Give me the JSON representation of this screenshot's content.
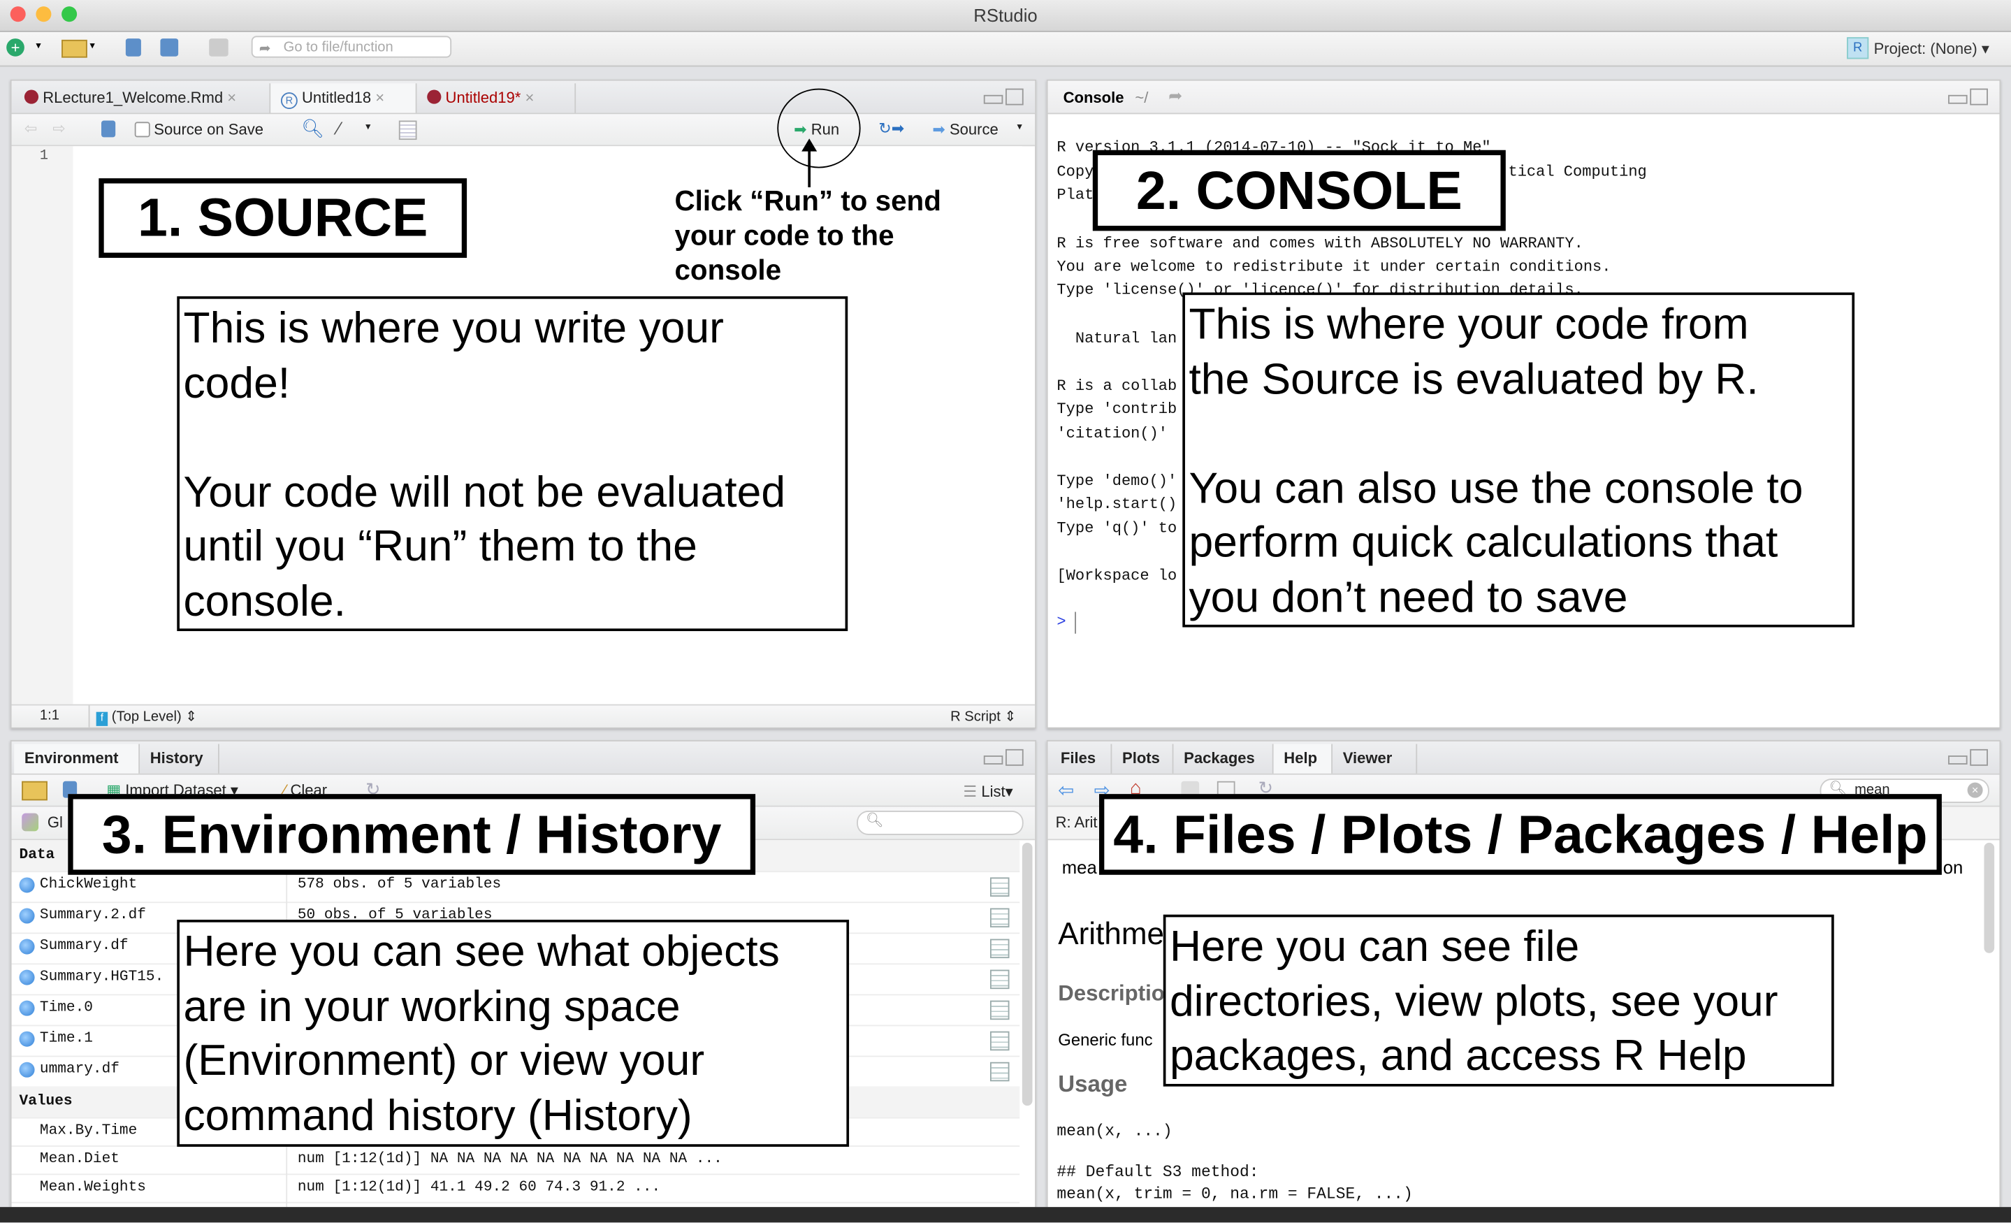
{
  "window": {
    "title": "RStudio",
    "traffic_lights": {
      "close": "#fc605c",
      "minimize": "#fdbc40",
      "zoom": "#34c84a"
    }
  },
  "toolbar": {
    "goto_placeholder": "Go to file/function",
    "project_label": "Project: (None)",
    "icons": [
      "new-file-icon",
      "open-folder-icon",
      "save-icon",
      "save-all-icon",
      "print-icon"
    ]
  },
  "source": {
    "tabs": [
      {
        "label": "RLecture1_Welcome.Rmd",
        "modified": false
      },
      {
        "label": "Untitled18",
        "modified": false,
        "active": true
      },
      {
        "label": "Untitled19*",
        "modified": true
      }
    ],
    "source_on_save": "Source on Save",
    "run_label": "Run",
    "source_label": "Source",
    "line_number": "1",
    "status": {
      "position": "1:1",
      "scope": "(Top Level)",
      "file_type": "R Script"
    }
  },
  "console": {
    "title": "Console",
    "path": "~/",
    "lines": [
      {
        "text": "R version 3.1.1 (2014-07-10) -- \"Sock it to Me\""
      },
      {
        "text": "Copy"
      },
      {
        "text": "tical Computing"
      },
      {
        "text": "Plat"
      },
      {
        "text": "R is free software and comes with ABSOLUTELY NO WARRANTY."
      },
      {
        "text": "You are welcome to redistribute it under certain conditions."
      },
      {
        "text": "Type 'license()' or 'licence()' for distribution details."
      },
      {
        "text": "  Natural lan"
      },
      {
        "text": "R is a collab"
      },
      {
        "text": "Type 'contrib"
      },
      {
        "text": "'citation()'"
      },
      {
        "text": "Type 'demo()'"
      },
      {
        "text": "'help.start()"
      },
      {
        "text": "Type 'q()' to"
      },
      {
        "text": "[Workspace lo"
      }
    ],
    "prompt": ">"
  },
  "environment": {
    "tabs": [
      "Environment",
      "History"
    ],
    "import_dataset": "Import Dataset",
    "clear": "Clear",
    "view_mode": "List",
    "scope": "Gl",
    "sections": {
      "data": "Data",
      "values": "Values"
    },
    "data_rows": [
      {
        "name": "ChickWeight",
        "value": "578 obs. of 5 variables"
      },
      {
        "name": "Summary.2.df",
        "value": "50 obs. of 5 variables"
      },
      {
        "name": "Summary.df",
        "value": ""
      },
      {
        "name": "Summary.HGT15.",
        "value": ""
      },
      {
        "name": "Time.0",
        "value": ""
      },
      {
        "name": "Time.1",
        "value": ""
      },
      {
        "name": "ummary.df",
        "value": ""
      }
    ],
    "value_rows": [
      {
        "name": "Max.By.Time",
        "value": ""
      },
      {
        "name": "Mean.Diet",
        "value": "num [1:12(1d)] NA NA NA NA NA NA NA NA NA NA ..."
      },
      {
        "name": "Mean.Weights",
        "value": "num [1:12(1d)] 41.1 49.2 60 74.3 91.2 ..."
      }
    ]
  },
  "files": {
    "tabs": [
      "Files",
      "Plots",
      "Packages",
      "Help",
      "Viewer"
    ],
    "active_tab": "Help",
    "search_value": "mean",
    "help_title": "R: Arit",
    "header_left": "mea",
    "header_right": "on",
    "heading": "Arithme",
    "description_heading": "Descriptio",
    "description_text": "Generic func",
    "usage_heading": "Usage",
    "usage_lines": [
      "mean(x, ...)",
      "## Default S3 method:",
      "mean(x, trim = 0, na.rm = FALSE, ...)"
    ]
  },
  "annotations": {
    "source_title": "1. SOURCE",
    "run_hint": [
      "Click “Run” to send",
      "your code to the",
      "console"
    ],
    "source_desc": [
      "This is where you write your",
      "code!",
      "",
      "Your code will not be evaluated",
      "until you “Run” them to the",
      "console."
    ],
    "console_title": "2. CONSOLE",
    "console_desc": [
      "This is where your code from",
      "the Source is evaluated by R.",
      "",
      "You can also use the console to",
      "perform quick calculations that",
      "you don’t need to save"
    ],
    "env_title": "3. Environment / History",
    "env_desc": [
      "Here you can see what objects",
      "are in your working space",
      "(Environment) or view your",
      "command history (History)"
    ],
    "files_title": "4. Files / Plots / Packages / Help",
    "files_desc": [
      "Here you can see file",
      "directories, view plots, see your",
      "packages, and access R Help"
    ]
  }
}
